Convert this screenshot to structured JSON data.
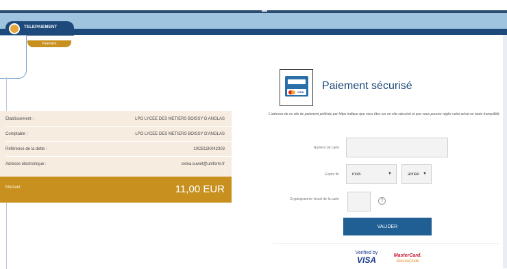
{
  "header": {
    "title": "TELEPAIEMENT",
    "subtab": "Paiement"
  },
  "info": {
    "rows": [
      {
        "label": "Etablissement :",
        "value": "LPO LYCEE DES METIERS BOISSY D ANGLAS"
      },
      {
        "label": "Comptable :",
        "value": "LPO LYCEE DES METIERS BOISSY D'ANGLAS"
      },
      {
        "label": "Référence de la dette :",
        "value": "10CB12K042303"
      },
      {
        "label": "Adresse électronique :",
        "value": "oxtea.suwet@uniform.fr"
      }
    ],
    "amount_label": "Montant",
    "amount_value": "11,00 EUR"
  },
  "payment": {
    "title": "Paiement sécurisé",
    "notice": "L'adresse de ce site de paiement préfixée par https indique que vous êtes sur un site sécurisé et que vous pouvez régler votre achat en toute tranquillité.",
    "card_number_label": "Numéro de carte",
    "card_number_value": "",
    "expiry_label": "Expire fin",
    "month_value": "mois",
    "year_value": "année",
    "cvv_label": "Cryptogramme visuel de la carte",
    "cvv_value": "",
    "help_symbol": "?",
    "validate_label": "VALIDER"
  },
  "badges": {
    "vbv_line1": "Verified by",
    "vbv_line2": "VISA",
    "mc_line1": "MasterCard.",
    "mc_line2": "SecureCode"
  },
  "colors": {
    "navy": "#1d4a7a",
    "gold": "#c8911f",
    "button": "#1f5f93",
    "panel": "#f6ece0"
  }
}
